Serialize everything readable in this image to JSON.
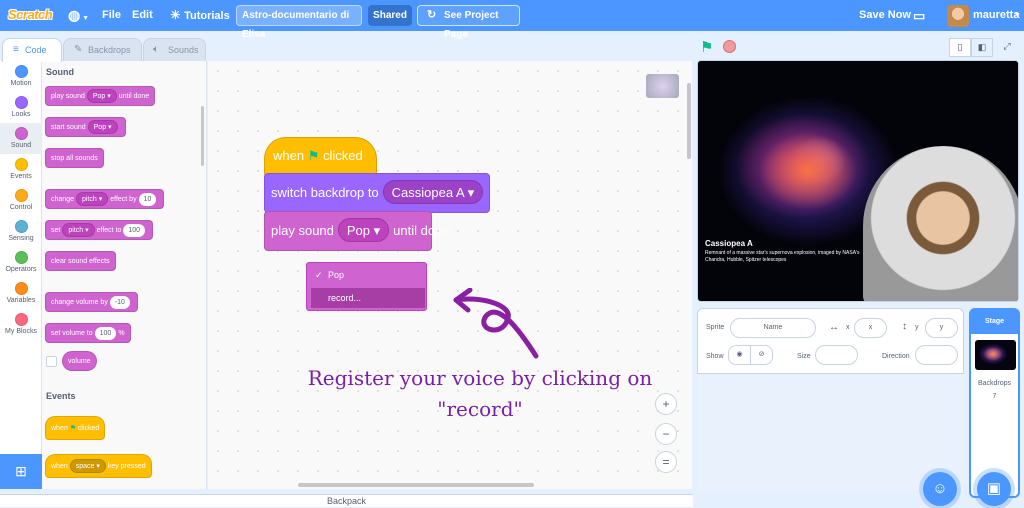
{
  "menubar": {
    "logo": "Scratch",
    "file": "File",
    "edit": "Edit",
    "tutorials": "Tutorials",
    "project_title": "Astro-documentario di Elisa",
    "shared": "Shared",
    "see_project_page": "See Project Page",
    "save_now": "Save Now",
    "username": "mauretta"
  },
  "tabs": {
    "code": "Code",
    "backdrops": "Backdrops",
    "sounds": "Sounds"
  },
  "categories": [
    {
      "label": "Motion",
      "color": "#4c97ff"
    },
    {
      "label": "Looks",
      "color": "#9966ff"
    },
    {
      "label": "Sound",
      "color": "#cf63cf"
    },
    {
      "label": "Events",
      "color": "#ffbf00"
    },
    {
      "label": "Control",
      "color": "#ffab19"
    },
    {
      "label": "Sensing",
      "color": "#5cb1d6"
    },
    {
      "label": "Operators",
      "color": "#59c059"
    },
    {
      "label": "Variables",
      "color": "#ff8c1a"
    },
    {
      "label": "My Blocks",
      "color": "#ff6680"
    }
  ],
  "palette": {
    "sound_heading": "Sound",
    "play_sound": "play sound",
    "until_done": "until done",
    "pop": "Pop",
    "start_sound": "start sound",
    "stop_all_sounds": "stop all sounds",
    "change": "change",
    "pitch": "pitch",
    "effect_by": "effect by",
    "effect_by_value": "10",
    "set": "set",
    "effect_to": "effect to",
    "effect_to_value": "100",
    "clear_sound_effects": "clear sound effects",
    "change_volume_by": "change volume by",
    "change_volume_value": "-10",
    "set_volume_to": "set volume to",
    "set_volume_value": "100",
    "percent": "%",
    "volume": "volume",
    "events_heading": "Events",
    "when": "when",
    "clicked": "clicked",
    "space": "space",
    "key_pressed": "key pressed"
  },
  "script": {
    "when": "when",
    "clicked": "clicked",
    "switch_backdrop_to": "switch backdrop to",
    "backdrop_value": "Cassiopea A",
    "play_sound": "play sound",
    "sound_value": "Pop",
    "until_done": "until done"
  },
  "sound_menu": {
    "check": "✓",
    "pop": "Pop",
    "record": "record..."
  },
  "annotation": {
    "line1": "Register your voice by clicking on",
    "line2": "\"record\""
  },
  "zoom": {
    "in": "+",
    "out": "−",
    "reset": "="
  },
  "stage": {
    "caption_title": "Cassiopea A",
    "caption_text": "Remnant of a massive star's supernova explosion, imaged by NASA's Chandra, Hubble, Spitzer telescopes"
  },
  "sprite_info": {
    "sprite_label": "Sprite",
    "name_placeholder": "Name",
    "x_label": "x",
    "x_placeholder": "x",
    "y_label": "y",
    "y_placeholder": "y",
    "show_label": "Show",
    "size_label": "Size",
    "direction_label": "Direction"
  },
  "stage_pane": {
    "label": "Stage",
    "backdrops_label": "Backdrops",
    "backdrops_count": "7"
  },
  "backpack": "Backpack"
}
